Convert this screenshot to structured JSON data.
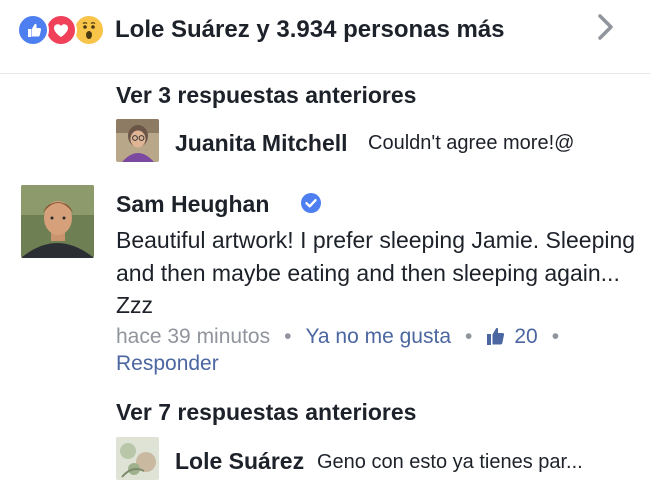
{
  "reactions": {
    "summary": "Lole Suárez y 3.934 personas más",
    "icons": [
      "like-icon",
      "love-icon",
      "wow-icon"
    ],
    "colors": {
      "like": "#4e7ff0",
      "love": "#f0405a",
      "wow": "#f8c54a"
    }
  },
  "thread1": {
    "view_previous": "Ver 3 respuestas anteriores",
    "reply": {
      "author": "Juanita Mitchell",
      "text": "Couldn't agree more!@"
    }
  },
  "comment": {
    "author": "Sam Heughan",
    "verified_icon": "verified-badge-icon",
    "text": "Beautiful artwork! I prefer sleeping Jamie. Sleeping and then maybe eating and then sleeping again... Zzz",
    "time": "hace 39 minutos",
    "unlike_label": "Ya no me gusta",
    "like_count": "20",
    "reply_label": "Responder",
    "link_color": "#4b66a0"
  },
  "thread2": {
    "view_previous": "Ver 7 respuestas anteriores",
    "reply": {
      "author": "Lole Suárez",
      "text": "Geno con esto ya tienes par..."
    }
  }
}
